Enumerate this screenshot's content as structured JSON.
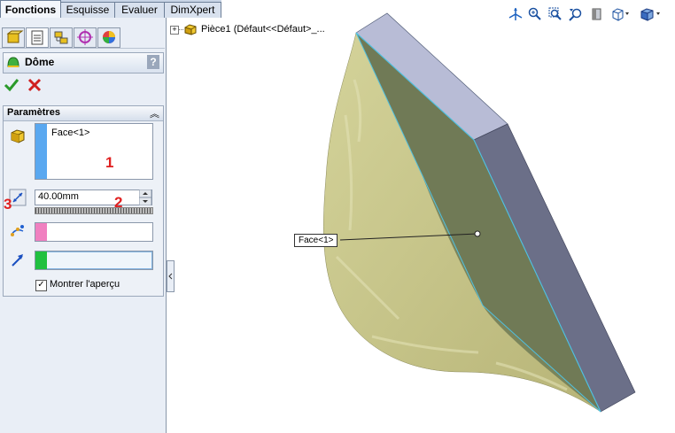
{
  "tabs": [
    "Fonctions",
    "Esquisse",
    "Evaluer",
    "DimXpert"
  ],
  "panel_tabs": [
    "feature-manager-icon",
    "property-manager-icon",
    "configuration-manager-icon",
    "dimxpert-manager-icon",
    "display-manager-icon"
  ],
  "feature": {
    "title": "Dôme",
    "help": "?"
  },
  "parameters": {
    "header": "Paramètres",
    "face_selection": "Face<1>",
    "distance": "40.00mm",
    "show_preview_label": "Montrer l'aperçu",
    "show_preview_checked": true
  },
  "annotations": [
    "1",
    "2",
    "3"
  ],
  "tree": {
    "root": "Pièce1  (Défaut<<Défaut>_..."
  },
  "callout": "Face<1>",
  "colors": {
    "selection_blue": "#5aa8f0",
    "selection_pink": "#f080c0",
    "selection_green": "#20c040",
    "model_yellow": "#c9c88a",
    "model_face": "#6f7a55",
    "model_side": "#6b6f88"
  }
}
